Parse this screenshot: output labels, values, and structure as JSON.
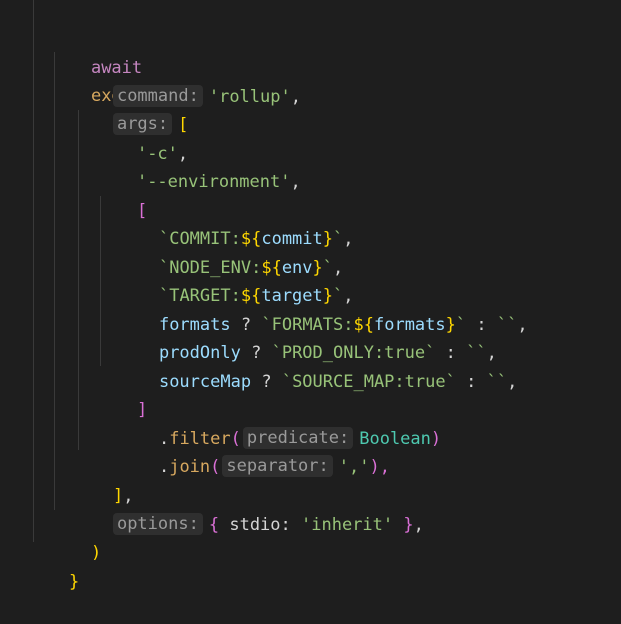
{
  "colors": {
    "background": "#1e1e1e",
    "keyword": "#c586c0",
    "function": "#d7a85f",
    "string": "#98c379",
    "identifier": "#9cdcfe",
    "hint_bg": "#2f2f2f",
    "hint_text": "#9a9a9a",
    "brace": "#ffd700",
    "bracket_purple": "#da70d6",
    "boolean": "#4fc1ff",
    "constant": "#4ec9b0"
  },
  "code": {
    "line1": {
      "kw": "await",
      "fn": "exec",
      "paren": "("
    },
    "line2": {
      "hint": "command:",
      "value": "'rollup'",
      "comma": ","
    },
    "line3": {
      "hint": "args:",
      "bracket": "["
    },
    "line4": {
      "value": "'-c'",
      "comma": ","
    },
    "line5": {
      "value": "'--environment'",
      "comma": ","
    },
    "line6": {
      "bracket": "["
    },
    "line7": {
      "tick_open": "`",
      "prefix": "COMMIT:",
      "dollar": "${",
      "var": "commit",
      "close_brace": "}",
      "tick_close": "`",
      "comma": ","
    },
    "line8": {
      "tick_open": "`",
      "prefix": "NODE_ENV:",
      "dollar": "${",
      "var": "env",
      "close_brace": "}",
      "tick_close": "`",
      "comma": ","
    },
    "line9": {
      "tick_open": "`",
      "prefix": "TARGET:",
      "dollar": "${",
      "var": "target",
      "close_brace": "}",
      "tick_close": "`",
      "comma": ","
    },
    "line10": {
      "cond": "formats",
      "q": "?",
      "tick_open": "`",
      "prefix": "FORMATS:",
      "dollar": "${",
      "var": "formats",
      "close_brace": "}",
      "tick_close": "`",
      "colon": ":",
      "empty": "``",
      "comma": ","
    },
    "line11": {
      "cond": "prodOnly",
      "q": "?",
      "tmpl": "`PROD_ONLY:true`",
      "colon": ":",
      "empty": "``",
      "comma": ","
    },
    "line12": {
      "cond": "sourceMap",
      "q": "?",
      "tmpl": "`SOURCE_MAP:true`",
      "colon": ":",
      "empty": "``",
      "comma": ","
    },
    "line13": {
      "bracket": "]"
    },
    "line14": {
      "dot": ".",
      "method": "filter",
      "open": "(",
      "hint": "predicate:",
      "arg": "Boolean",
      "close": ")"
    },
    "line15": {
      "dot": ".",
      "method": "join",
      "open": "(",
      "hint": "separator:",
      "arg": "','",
      "close": "),"
    },
    "line16": {
      "bracket": "]",
      "comma": ","
    },
    "line17": {
      "hint": "options:",
      "open": "{",
      "key": "stdio:",
      "value": "'inherit'",
      "close": "}",
      "comma": ","
    },
    "line18": {
      "paren": ")"
    },
    "line19": {
      "brace": "}"
    }
  }
}
